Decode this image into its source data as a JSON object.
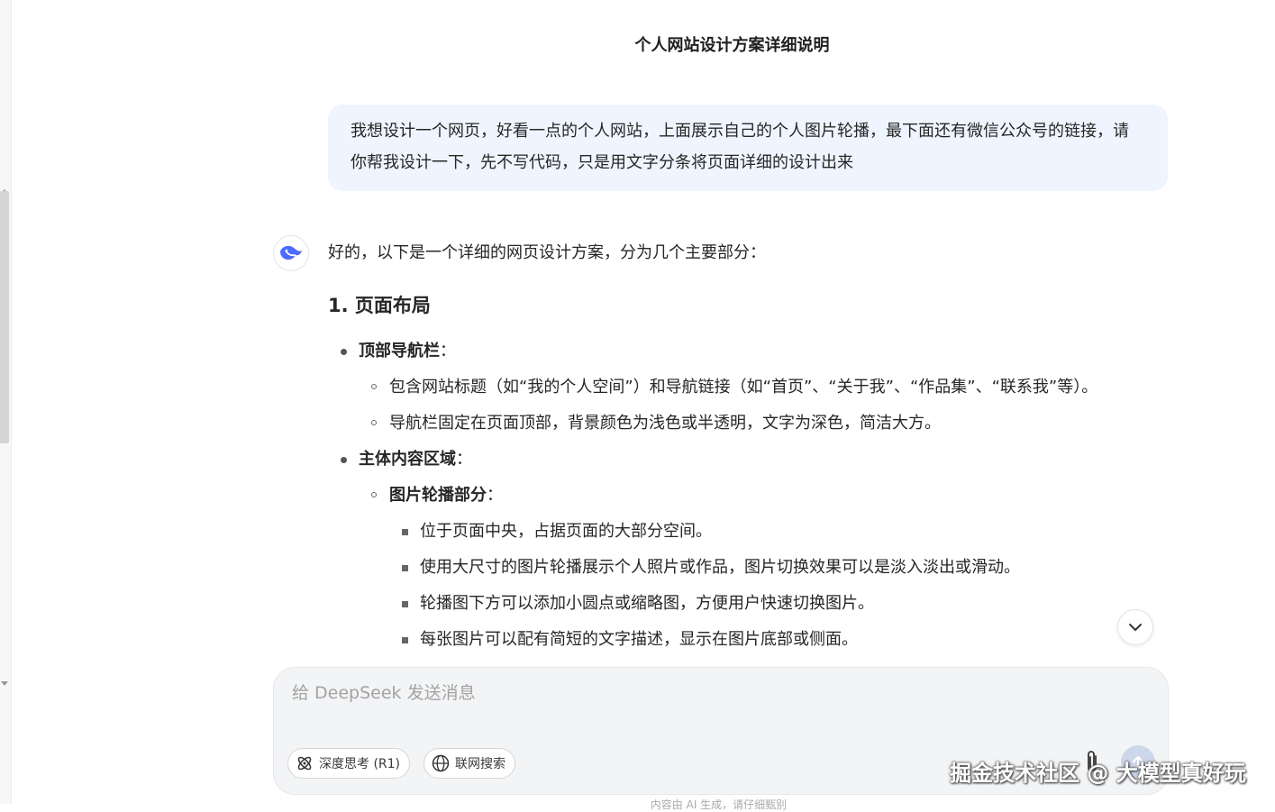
{
  "chat": {
    "title": "个人网站设计方案详细说明"
  },
  "user_message": "我想设计一个网页，好看一点的个人网站，上面展示自己的个人图片轮播，最下面还有微信公众号的链接，请你帮我设计一下，先不写代码，只是用文字分条将页面详细的设计出来",
  "assistant": {
    "avatar_icon": "deepseek-whale-icon",
    "intro": "好的，以下是一个详细的网页设计方案，分为几个主要部分：",
    "section_heading": "1. 页面布局",
    "nav": {
      "label": "顶部导航栏",
      "colon": "：",
      "items": [
        "包含网站标题（如“我的个人空间”）和导航链接（如“首页”、“关于我”、“作品集”、“联系我”等）。",
        "导航栏固定在页面顶部，背景颜色为浅色或半透明，文字为深色，简洁大方。"
      ]
    },
    "main": {
      "label": "主体内容区域",
      "colon": "：",
      "carousel": {
        "label": "图片轮播部分",
        "colon": "：",
        "items": [
          "位于页面中央，占据页面的大部分空间。",
          "使用大尺寸的图片轮播展示个人照片或作品，图片切换效果可以是淡入淡出或滑动。",
          "轮播图下方可以添加小圆点或缩略图，方便用户快速切换图片。",
          "每张图片可以配有简短的文字描述，显示在图片底部或侧面。"
        ]
      }
    }
  },
  "composer": {
    "placeholder": "给 DeepSeek 发送消息",
    "deep_think_label": "深度思考 (R1)",
    "web_search_label": "联网搜索"
  },
  "disclaimer": "内容由 AI 生成，请仔细甄别",
  "watermark": "掘金技术社区 @ 大模型真好玩",
  "colors": {
    "user_bubble_bg": "#eff5ff",
    "accent_blue": "#4d6bfe",
    "composer_bg": "#f3f4f6"
  }
}
